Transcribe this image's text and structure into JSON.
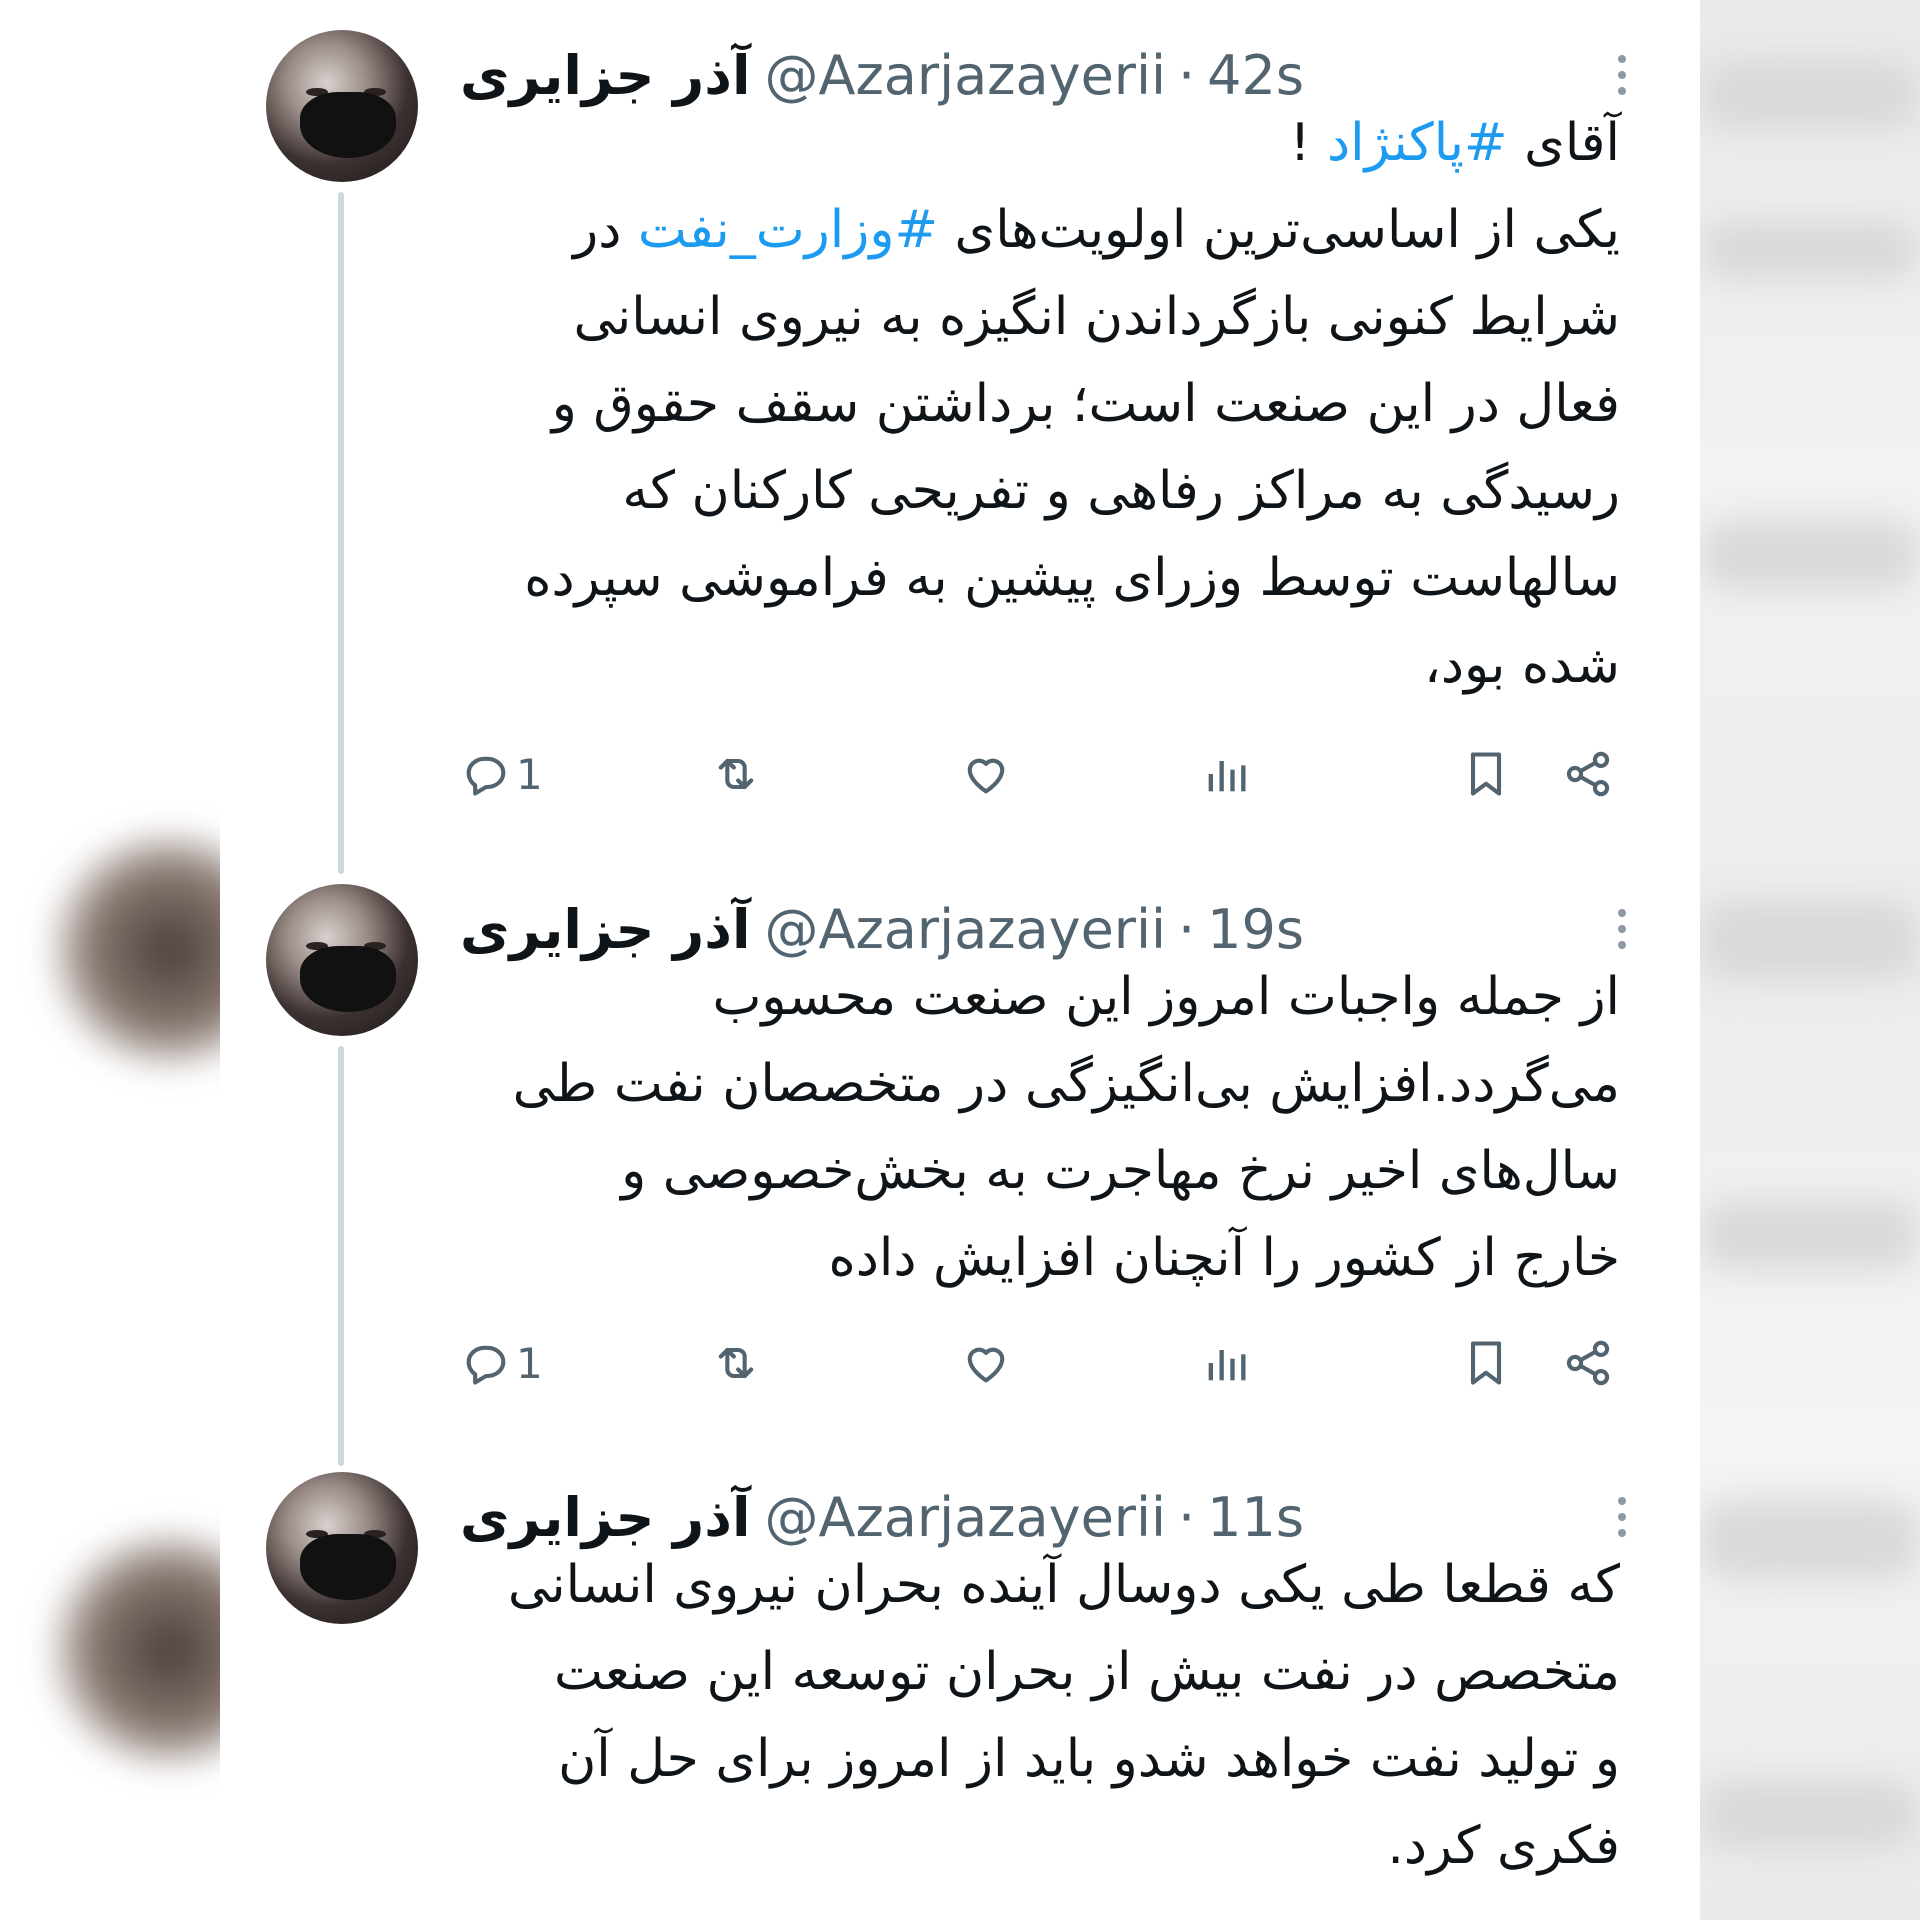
{
  "tweets": [
    {
      "name": "آذر جزایری",
      "handle": "@Azarjazayerii",
      "separator": "·",
      "time": "42s",
      "lines": [
        [
          {
            "t": "آقای "
          },
          {
            "t": "#پاکنژاد",
            "tag": true
          },
          {
            "t": " !"
          }
        ],
        [
          {
            "t": "یکی از اساسی‌ترین اولویت‌های "
          },
          {
            "t": "#وزارت_نفت",
            "tag": true
          },
          {
            "t": " در"
          }
        ],
        [
          {
            "t": "شرایط کنونی بازگرداندن انگیزه به نیروی انسانی"
          }
        ],
        [
          {
            "t": "فعال در این صنعت است؛ برداشتن سقف حقوق و"
          }
        ],
        [
          {
            "t": "رسیدگی به مراکز رفاهی و تفریحی کارکنان که"
          }
        ],
        [
          {
            "t": "سالهاست توسط وزرای پیشین به فراموشی سپرده"
          }
        ],
        [
          {
            "t": "شده بود،"
          }
        ]
      ],
      "reply_count": "1"
    },
    {
      "name": "آذر جزایری",
      "handle": "@Azarjazayerii",
      "separator": "·",
      "time": "19s",
      "lines": [
        [
          {
            "t": "از جمله واجبات امروز این صنعت محسوب"
          }
        ],
        [
          {
            "t": "می‌گردد.افزایش بی‌انگیزگی در متخصصان نفت طی"
          }
        ],
        [
          {
            "t": "سال‌های اخیر نرخ مهاجرت به بخش‌خصوصی و"
          }
        ],
        [
          {
            "t": "خارج از کشور را آنچنان افزایش داده"
          }
        ]
      ],
      "reply_count": "1"
    },
    {
      "name": "آذر جزایری",
      "handle": "@Azarjazayerii",
      "separator": "·",
      "time": "11s",
      "lines": [
        [
          {
            "t": "که قطعا طی یکی دوسال آینده بحران نیروی انسانی"
          }
        ],
        [
          {
            "t": "متخصص در نفت بیش از بحران توسعه این صنعت"
          }
        ],
        [
          {
            "t": "و تولید نفت خواهد شدو باید از امروز برای حل آن"
          }
        ],
        [
          {
            "t": "فکری کرد."
          }
        ]
      ]
    }
  ],
  "icons": {
    "reply": "reply-icon",
    "retweet": "retweet-icon",
    "like": "heart-icon",
    "views": "views-icon",
    "bookmark": "bookmark-icon",
    "share": "share-icon",
    "more": "more-vertical-icon"
  },
  "colors": {
    "hashtag": "#1d9bf0",
    "muted": "#536471",
    "text": "#0f1419",
    "thread_line": "#cfd9de"
  }
}
